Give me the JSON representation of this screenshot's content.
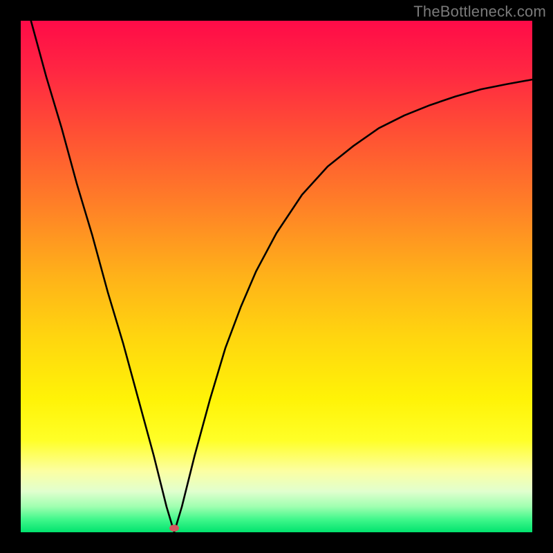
{
  "watermark": {
    "text": "TheBottleneck.com"
  },
  "gradient": {
    "stops": [
      {
        "offset": 0.0,
        "color": "#ff0b48"
      },
      {
        "offset": 0.1,
        "color": "#ff2742"
      },
      {
        "offset": 0.22,
        "color": "#ff5034"
      },
      {
        "offset": 0.35,
        "color": "#ff7c28"
      },
      {
        "offset": 0.5,
        "color": "#ffb219"
      },
      {
        "offset": 0.62,
        "color": "#ffd60f"
      },
      {
        "offset": 0.74,
        "color": "#fff307"
      },
      {
        "offset": 0.82,
        "color": "#ffff27"
      },
      {
        "offset": 0.88,
        "color": "#fcffa2"
      },
      {
        "offset": 0.92,
        "color": "#e1ffce"
      },
      {
        "offset": 0.95,
        "color": "#9fffb0"
      },
      {
        "offset": 0.975,
        "color": "#40f78b"
      },
      {
        "offset": 1.0,
        "color": "#01e36e"
      }
    ]
  },
  "marker": {
    "x_frac": 0.3,
    "y_frac": 0.992,
    "color": "#d4575f"
  },
  "chart_data": {
    "type": "line",
    "title": "",
    "xlabel": "",
    "ylabel": "",
    "xlim": [
      0,
      1
    ],
    "ylim": [
      0,
      1
    ],
    "series": [
      {
        "name": "bottleneck-curve",
        "x": [
          0.02,
          0.05,
          0.08,
          0.11,
          0.14,
          0.17,
          0.2,
          0.23,
          0.26,
          0.285,
          0.3,
          0.315,
          0.34,
          0.37,
          0.4,
          0.43,
          0.46,
          0.5,
          0.55,
          0.6,
          0.65,
          0.7,
          0.75,
          0.8,
          0.85,
          0.9,
          0.95,
          1.0
        ],
        "y": [
          1.0,
          0.89,
          0.79,
          0.68,
          0.58,
          0.47,
          0.37,
          0.26,
          0.15,
          0.05,
          0.0,
          0.05,
          0.15,
          0.26,
          0.36,
          0.44,
          0.51,
          0.585,
          0.66,
          0.715,
          0.755,
          0.79,
          0.815,
          0.835,
          0.852,
          0.866,
          0.876,
          0.885
        ]
      }
    ],
    "annotations": [
      {
        "type": "marker",
        "x": 0.3,
        "y": 0.0,
        "label": "optimal-point"
      }
    ]
  }
}
